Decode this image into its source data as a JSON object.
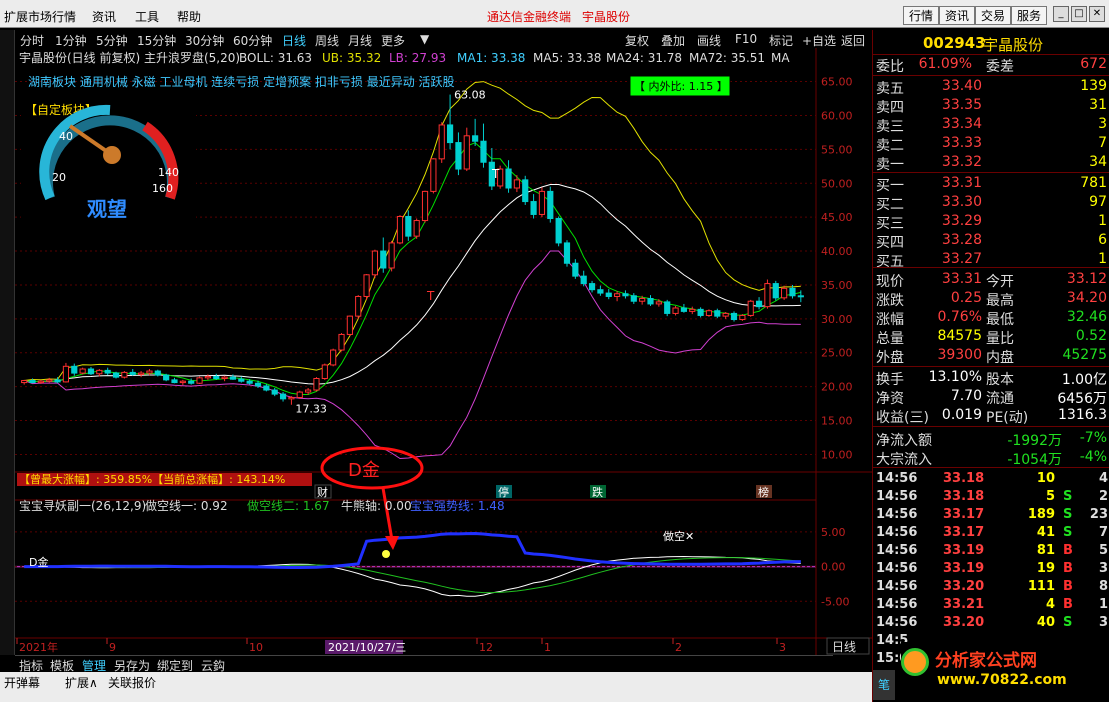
{
  "menu": [
    "扩展市场行情",
    "资讯",
    "工具",
    "帮助"
  ],
  "center_title": {
    "terminal": "通达信金融终端",
    "stock": "宇晶股份"
  },
  "top_buttons": [
    "行情",
    "资讯",
    "交易",
    "服务"
  ],
  "periods": [
    "分时",
    "1分钟",
    "5分钟",
    "15分钟",
    "30分钟",
    "60分钟",
    "日线",
    "周线",
    "月线",
    "更多"
  ],
  "period_active": "日线",
  "right_tools": [
    "复权",
    "叠加",
    "画线",
    "F10",
    "标记",
    "+自选",
    "返回"
  ],
  "main_header": {
    "name": "宇晶股份(日线 前复权) 主升浪罗盘(5,20)",
    "boll": "BOLL: 31.63",
    "ub": "UB: 35.32",
    "lb": "LB: 27.93",
    "ma1": "MA1: 33.38",
    "ma5": "MA5: 33.38",
    "ma24": "MA24: 31.78",
    "ma72": "MA72: 35.51",
    "ma_trunc": "MA"
  },
  "concepts": "湖南板块 通用机械 永磁 工业母机 连续亏损 定增预案 扣非亏损 最近异动 活跃股",
  "gauge": {
    "title": "【自定板块】:",
    "label": "观望",
    "ticks": [
      "20",
      "40",
      "60",
      "80",
      "100",
      "120",
      "140",
      "160"
    ]
  },
  "inout_ratio": "【 内外比: 1.15 】",
  "price_axis": [
    "65.00",
    "60.00",
    "55.00",
    "50.00",
    "45.00",
    "40.00",
    "35.00",
    "30.00",
    "25.00",
    "20.00",
    "15.00",
    "10.00"
  ],
  "high_label": "63.08",
  "low_label": "17.33",
  "markers": {
    "t1": "T",
    "t2": "T"
  },
  "stat_text": "【曾最大涨幅】: 359.85%【当前总涨幅】: 143.14%",
  "events": {
    "cai": "财",
    "ting": "停",
    "die": "跌",
    "bang": "榜"
  },
  "annotation": "D金",
  "sub_header": {
    "name": "宝宝寻妖副一(26,12,9)",
    "line1": "做空线一: 0.92",
    "line2": "做空线二: 1.67",
    "line3": "牛熊轴: 0.00",
    "line4": "宝宝强势线: 1.48"
  },
  "sub_axis": [
    "5.00",
    "0.00",
    "-5.00"
  ],
  "sub_labels": {
    "djin": "D金",
    "dsi": "做空✕"
  },
  "date_axis": [
    "2021年",
    "9",
    "10",
    "2021/10/27/三",
    "12",
    "1",
    "2",
    "3"
  ],
  "period_label": "日线",
  "bottom_tabs": [
    "指标",
    "模板",
    "管理",
    "另存为",
    "绑定到",
    "云鈎"
  ],
  "bottom_left": [
    "开弹幕",
    "扩展∧",
    "关联报价"
  ],
  "quote": {
    "code": "002943",
    "name": "宇晶股份",
    "webi_label": "委比",
    "webi": "61.09%",
    "wecha_label": "委差",
    "wecha": "672",
    "asks": [
      {
        "l": "卖五",
        "p": "33.40",
        "v": "139"
      },
      {
        "l": "卖四",
        "p": "33.35",
        "v": "31"
      },
      {
        "l": "卖三",
        "p": "33.34",
        "v": "3"
      },
      {
        "l": "卖二",
        "p": "33.33",
        "v": "7"
      },
      {
        "l": "卖一",
        "p": "33.32",
        "v": "34"
      }
    ],
    "bids": [
      {
        "l": "买一",
        "p": "33.31",
        "v": "781"
      },
      {
        "l": "买二",
        "p": "33.30",
        "v": "97"
      },
      {
        "l": "买三",
        "p": "33.29",
        "v": "1"
      },
      {
        "l": "买四",
        "p": "33.28",
        "v": "6"
      },
      {
        "l": "买五",
        "p": "33.27",
        "v": "1"
      }
    ],
    "stats": [
      {
        "l": "现价",
        "v": "33.31",
        "l2": "今开",
        "v2": "33.12"
      },
      {
        "l": "涨跌",
        "v": "0.25",
        "l2": "最高",
        "v2": "34.20"
      },
      {
        "l": "涨幅",
        "v": "0.76%",
        "l2": "最低",
        "v2": "32.46",
        "v2c": "green"
      },
      {
        "l": "总量",
        "v": "84575",
        "l2": "量比",
        "v2": "0.52",
        "vc": "yellow",
        "v2c": "green"
      },
      {
        "l": "外盘",
        "v": "39300",
        "l2": "内盘",
        "v2": "45275",
        "v2c": "green"
      }
    ],
    "stats2": [
      {
        "l": "换手",
        "v": "13.10%",
        "l2": "股本",
        "v2": "1.00亿"
      },
      {
        "l": "净资",
        "v": "7.70",
        "l2": "流通",
        "v2": "6456万"
      },
      {
        "l": "收益(三)",
        "v": "0.019",
        "l2": "PE(动)",
        "v2": "1316.3"
      }
    ],
    "flows": [
      {
        "l": "净流入额",
        "v": "-1992万",
        "p": "-7%"
      },
      {
        "l": "大宗流入",
        "v": "-1054万",
        "p": "-4%"
      }
    ],
    "ticks": [
      {
        "t": "14:56",
        "p": "33.18",
        "q": "10",
        "s": "",
        "n": "4"
      },
      {
        "t": "14:56",
        "p": "33.18",
        "q": "5",
        "s": "S",
        "n": "2"
      },
      {
        "t": "14:56",
        "p": "33.17",
        "q": "189",
        "s": "S",
        "n": "23"
      },
      {
        "t": "14:56",
        "p": "33.17",
        "q": "41",
        "s": "S",
        "n": "7"
      },
      {
        "t": "14:56",
        "p": "33.19",
        "q": "81",
        "s": "B",
        "n": "5"
      },
      {
        "t": "14:56",
        "p": "33.19",
        "q": "19",
        "s": "B",
        "n": "3"
      },
      {
        "t": "14:56",
        "p": "33.20",
        "q": "111",
        "s": "B",
        "n": "8"
      },
      {
        "t": "14:56",
        "p": "33.21",
        "q": "4",
        "s": "B",
        "n": "1"
      },
      {
        "t": "14:56",
        "p": "33.20",
        "q": "40",
        "s": "S",
        "n": "3"
      },
      {
        "t": "14:5",
        "p": "",
        "q": "",
        "s": "",
        "n": ""
      },
      {
        "t": "15:0",
        "p": "",
        "q": "",
        "s": "",
        "n": ""
      }
    ],
    "side_tab": "笔"
  },
  "watermark": {
    "brand": "分析家公式网",
    "url": "www.70822.com"
  },
  "colors": {
    "up": "#ff3030",
    "down": "#00d0d0",
    "ma1": "#ffffff",
    "ma24": "#00e000",
    "ub": "#e0e000",
    "lb": "#d040d0",
    "sub_white": "#ffffff",
    "sub_green": "#20c020",
    "sub_blue": "#2030ff",
    "sub_axis": "#b030b0"
  },
  "chart_data": {
    "type": "candlestick",
    "ylim": [
      8,
      67
    ],
    "candles": [
      [
        20.6,
        21.0,
        20.3,
        20.9
      ],
      [
        20.9,
        21.2,
        20.5,
        20.6
      ],
      [
        20.6,
        21.0,
        20.4,
        20.8
      ],
      [
        20.8,
        21.3,
        20.6,
        21.0
      ],
      [
        21.0,
        21.4,
        20.5,
        20.7
      ],
      [
        20.7,
        23.5,
        20.6,
        23.0
      ],
      [
        23.0,
        23.4,
        21.6,
        22.0
      ],
      [
        22.0,
        22.8,
        21.8,
        22.6
      ],
      [
        22.6,
        22.9,
        21.7,
        21.9
      ],
      [
        21.9,
        22.6,
        21.5,
        22.4
      ],
      [
        22.4,
        22.8,
        21.7,
        22.0
      ],
      [
        22.0,
        22.2,
        21.2,
        21.4
      ],
      [
        21.4,
        22.3,
        21.2,
        22.1
      ],
      [
        22.1,
        22.6,
        21.6,
        21.8
      ],
      [
        21.8,
        22.3,
        21.4,
        22.0
      ],
      [
        22.0,
        22.6,
        21.7,
        22.3
      ],
      [
        22.3,
        22.5,
        21.5,
        21.7
      ],
      [
        21.7,
        21.9,
        20.8,
        21.0
      ],
      [
        21.0,
        21.3,
        20.5,
        20.6
      ],
      [
        20.6,
        21.0,
        20.2,
        20.8
      ],
      [
        20.8,
        21.2,
        20.3,
        20.5
      ],
      [
        20.5,
        21.5,
        20.4,
        21.3
      ],
      [
        21.3,
        21.8,
        21.0,
        21.5
      ],
      [
        21.5,
        21.9,
        21.0,
        21.2
      ],
      [
        21.2,
        21.6,
        20.8,
        21.4
      ],
      [
        21.4,
        21.8,
        21.0,
        21.1
      ],
      [
        21.1,
        21.5,
        20.6,
        20.8
      ],
      [
        20.8,
        21.1,
        20.3,
        20.5
      ],
      [
        20.5,
        20.9,
        19.8,
        20.1
      ],
      [
        20.1,
        20.4,
        19.3,
        19.5
      ],
      [
        19.5,
        19.8,
        18.6,
        18.9
      ],
      [
        18.9,
        19.2,
        17.8,
        18.2
      ],
      [
        18.2,
        18.6,
        17.33,
        18.4
      ],
      [
        18.4,
        19.4,
        18.2,
        19.2
      ],
      [
        19.2,
        19.8,
        18.8,
        19.5
      ],
      [
        19.5,
        21.4,
        19.3,
        21.2
      ],
      [
        21.2,
        23.4,
        21.0,
        23.2
      ],
      [
        23.2,
        25.6,
        23.0,
        25.4
      ],
      [
        25.4,
        27.9,
        25.2,
        27.7
      ],
      [
        27.7,
        30.5,
        27.5,
        30.4
      ],
      [
        30.4,
        33.5,
        30.0,
        33.3
      ],
      [
        33.3,
        36.6,
        32.8,
        36.5
      ],
      [
        36.5,
        40.2,
        36.0,
        40.0
      ],
      [
        40.0,
        42.0,
        36.8,
        37.5
      ],
      [
        37.5,
        41.5,
        37.0,
        41.2
      ],
      [
        41.2,
        45.3,
        41.0,
        45.1
      ],
      [
        45.1,
        46.0,
        41.5,
        42.2
      ],
      [
        42.2,
        44.8,
        41.8,
        44.5
      ],
      [
        44.5,
        48.9,
        44.2,
        48.8
      ],
      [
        48.8,
        53.7,
        48.5,
        53.6
      ],
      [
        53.6,
        59.0,
        53.0,
        58.6
      ],
      [
        58.6,
        63.08,
        55.0,
        56.0
      ],
      [
        56.0,
        57.5,
        51.2,
        52.1
      ],
      [
        52.1,
        58.2,
        51.8,
        57.0
      ],
      [
        57.0,
        59.5,
        55.5,
        56.2
      ],
      [
        56.2,
        58.8,
        52.3,
        53.1
      ],
      [
        53.1,
        55.2,
        49.0,
        49.6
      ],
      [
        49.6,
        52.6,
        49.2,
        52.1
      ],
      [
        52.1,
        53.4,
        48.6,
        49.3
      ],
      [
        49.3,
        51.2,
        48.7,
        50.5
      ],
      [
        50.5,
        51.1,
        46.8,
        47.3
      ],
      [
        47.3,
        48.4,
        44.8,
        45.4
      ],
      [
        45.4,
        49.4,
        45.0,
        48.8
      ],
      [
        48.8,
        49.5,
        44.2,
        44.8
      ],
      [
        44.8,
        45.1,
        40.7,
        41.2
      ],
      [
        41.2,
        41.6,
        37.7,
        38.2
      ],
      [
        38.2,
        38.8,
        35.9,
        36.3
      ],
      [
        36.3,
        37.1,
        34.8,
        35.2
      ],
      [
        35.2,
        35.6,
        33.9,
        34.3
      ],
      [
        34.3,
        34.9,
        33.4,
        33.8
      ],
      [
        33.8,
        34.4,
        32.9,
        33.3
      ],
      [
        33.3,
        34.1,
        32.6,
        33.7
      ],
      [
        33.7,
        34.2,
        33.0,
        33.4
      ],
      [
        33.4,
        33.8,
        32.2,
        32.6
      ],
      [
        32.6,
        33.4,
        32.1,
        33.0
      ],
      [
        33.0,
        33.5,
        31.9,
        32.2
      ],
      [
        32.2,
        32.9,
        31.8,
        32.5
      ],
      [
        32.5,
        32.8,
        30.4,
        30.8
      ],
      [
        30.8,
        31.9,
        30.5,
        31.6
      ],
      [
        31.6,
        32.2,
        30.9,
        31.1
      ],
      [
        31.1,
        31.8,
        30.7,
        31.4
      ],
      [
        31.4,
        31.7,
        30.2,
        30.5
      ],
      [
        30.5,
        31.4,
        30.3,
        31.2
      ],
      [
        31.2,
        31.5,
        30.1,
        30.4
      ],
      [
        30.4,
        31.0,
        30.0,
        30.8
      ],
      [
        30.8,
        31.1,
        29.6,
        29.9
      ],
      [
        29.9,
        30.7,
        29.7,
        30.5
      ],
      [
        30.5,
        32.8,
        30.3,
        32.6
      ],
      [
        32.6,
        33.2,
        31.4,
        31.8
      ],
      [
        31.8,
        35.8,
        31.5,
        35.2
      ],
      [
        35.2,
        35.6,
        32.7,
        33.1
      ],
      [
        33.1,
        34.9,
        32.8,
        34.5
      ],
      [
        34.5,
        35.0,
        33.0,
        33.4
      ],
      [
        33.4,
        34.2,
        32.46,
        33.31
      ]
    ],
    "sub_range": [
      -10,
      7
    ]
  }
}
